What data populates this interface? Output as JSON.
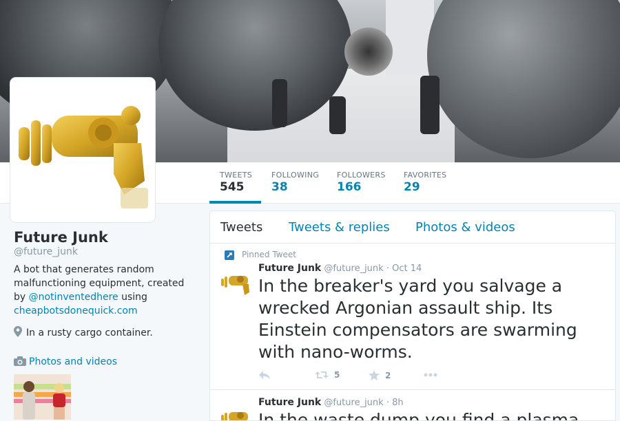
{
  "profile": {
    "name": "Future Junk",
    "handle": "@future_junk",
    "bio_prefix": "A bot that generates random malfunctioning equipment, created by",
    "bio_mention": "@notinventedhere",
    "bio_mid": "using",
    "bio_link": "cheapbotsdonequick.com",
    "location": "In a rusty cargo container.",
    "media_label": "Photos and videos"
  },
  "stats": [
    {
      "label": "TWEETS",
      "value": "545"
    },
    {
      "label": "FOLLOWING",
      "value": "38"
    },
    {
      "label": "FOLLOWERS",
      "value": "166"
    },
    {
      "label": "FAVORITES",
      "value": "29"
    }
  ],
  "tabs": [
    "Tweets",
    "Tweets & replies",
    "Photos & videos"
  ],
  "tweets": [
    {
      "pinned_label": "Pinned Tweet",
      "name": "Future Junk",
      "handle": "@future_junk",
      "time": "· Oct 14",
      "text": "In the breaker's yard you salvage a wrecked Argonian assault ship. Its Einstein compensators are swarming with nano-worms.",
      "retweets": "5",
      "favorites": "2"
    },
    {
      "name": "Future Junk",
      "handle": "@future_junk",
      "time": "· 8h",
      "text": "In the waste dump you find a plasma"
    }
  ],
  "colors": {
    "link": "#0084b4",
    "text": "#292f33",
    "muted": "#8899a6",
    "avatar_gold": "#d4a526"
  }
}
